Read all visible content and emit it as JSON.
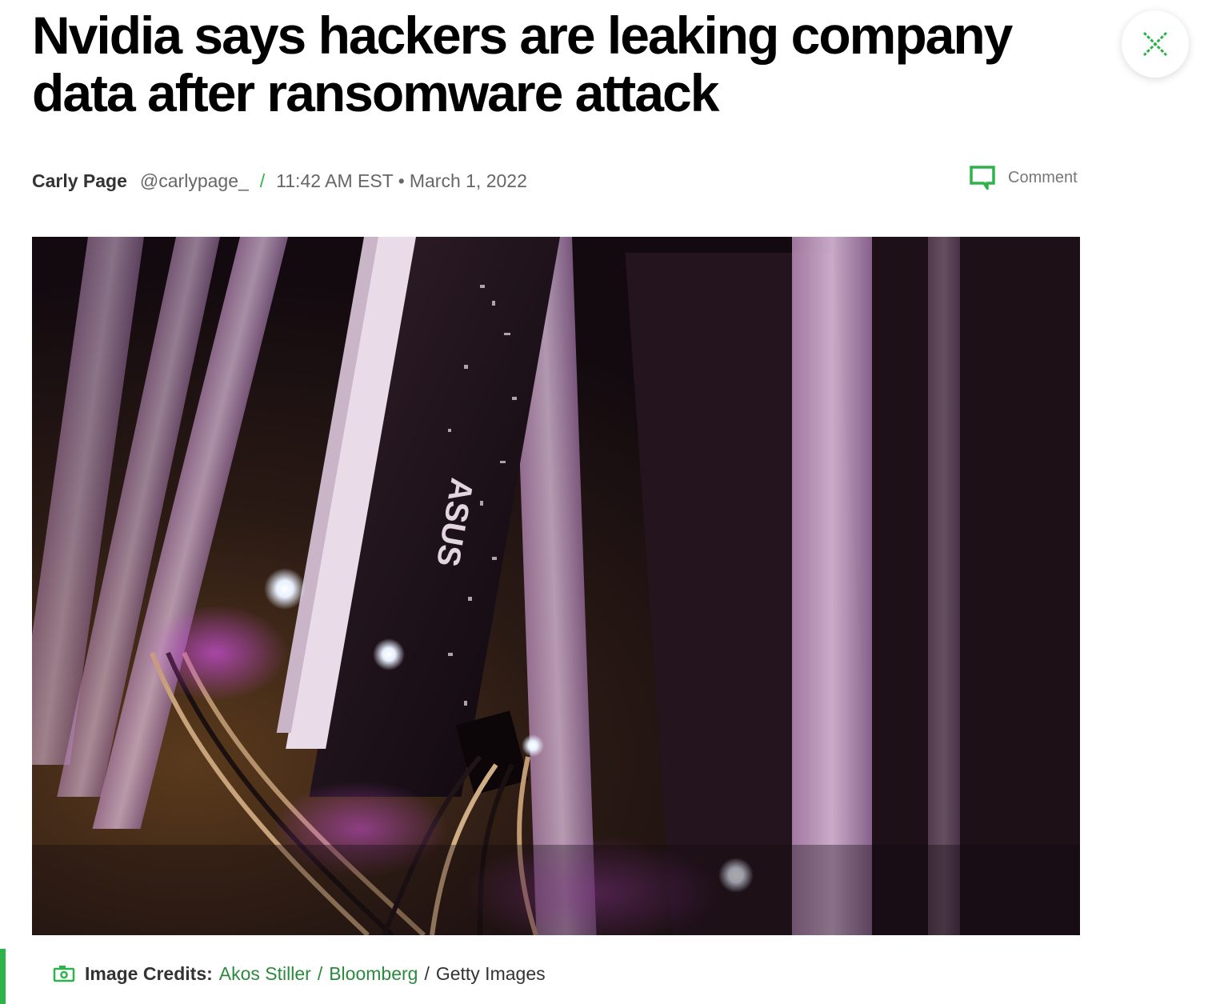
{
  "article": {
    "headline": "Nvidia says hackers are leaking company data after ransomware attack",
    "author": "Carly Page",
    "handle": "@carlypage_",
    "separator": "/",
    "time": "11:42 AM EST",
    "date_sep": "•",
    "date": "March 1, 2022",
    "comment_label": "Comment"
  },
  "image": {
    "brand_text": "ASUS"
  },
  "credits": {
    "label": "Image Credits:",
    "photographer": "Akos Stiller",
    "sep1": "/",
    "agency": "Bloomberg",
    "sep2": "/",
    "source": "Getty Images"
  },
  "colors": {
    "accent": "#2db34a",
    "link": "#2b8a3e"
  },
  "icons": [
    "close-icon",
    "comment-icon",
    "camera-icon"
  ]
}
